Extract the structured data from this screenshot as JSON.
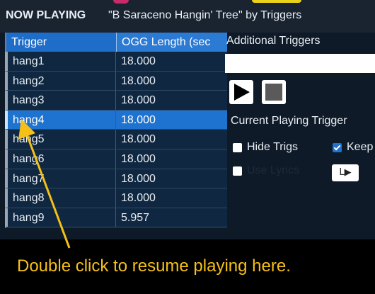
{
  "header": {
    "title": "NOW PLAYING",
    "song": "\"B Saraceno Hangin' Tree\" by Triggers"
  },
  "table": {
    "columns": [
      "Trigger",
      "OGG Length (sec"
    ],
    "rows": [
      {
        "trigger": "hang1",
        "length": "18.000"
      },
      {
        "trigger": "hang2",
        "length": "18.000"
      },
      {
        "trigger": "hang3",
        "length": "18.000"
      },
      {
        "trigger": "hang4",
        "length": "18.000"
      },
      {
        "trigger": "hang5",
        "length": "18.000"
      },
      {
        "trigger": "hang6",
        "length": "18.000"
      },
      {
        "trigger": "hang7",
        "length": "18.000"
      },
      {
        "trigger": "hang8",
        "length": "18.000"
      },
      {
        "trigger": "hang9",
        "length": "5.957"
      }
    ],
    "selected_index": 3
  },
  "controls": {
    "additional_label": "Additional Triggers",
    "additional_value": "",
    "current_label": "Current Playing Trigger",
    "hide_trigs_label": "Hide Trigs",
    "hide_trigs_checked": false,
    "keep_label": "Keep",
    "keep_checked": true,
    "use_lyrics_label": "Use Lyrics",
    "use_lyrics_checked": false,
    "lyrics_button_label": "L▶"
  },
  "annotation": {
    "caption": "Double click to resume playing here.",
    "color": "#f5c018"
  },
  "colors": {
    "selection": "#1e73d0",
    "header_bg": "#1a2430",
    "panel_bg": "#0f1a28"
  }
}
